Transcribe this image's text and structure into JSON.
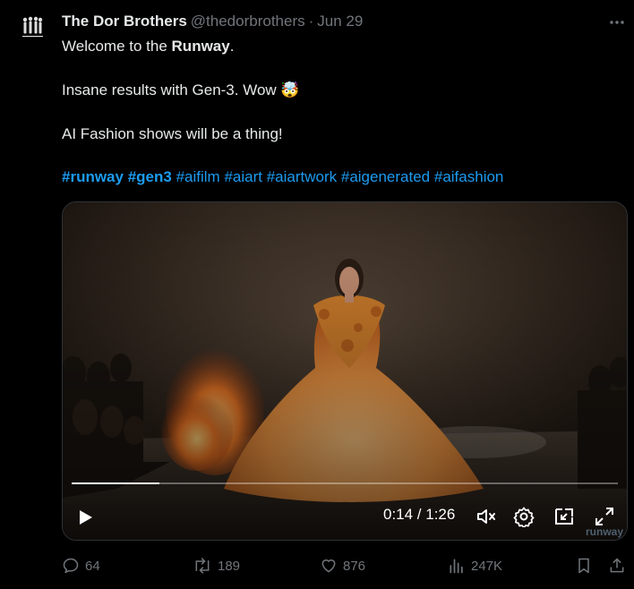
{
  "tweet": {
    "author_name": "The Dor Brothers",
    "handle": "@thedorbrothers",
    "separator": "·",
    "date": "Jun 29",
    "line1_prefix": "Welcome to the ",
    "line1_bold": "Runway",
    "line1_suffix": ".",
    "line2": "Insane results with Gen-3. Wow",
    "line2_emoji": "🤯",
    "line3": "AI Fashion shows will be a thing!",
    "hashtags": [
      {
        "text": "#runway",
        "bold": true
      },
      {
        "text": "#gen3",
        "bold": true
      },
      {
        "text": "#aifilm",
        "bold": false
      },
      {
        "text": "#aiart",
        "bold": false
      },
      {
        "text": "#aiartwork",
        "bold": false
      },
      {
        "text": "#aigenerated",
        "bold": false
      },
      {
        "text": "#aifashion",
        "bold": false
      }
    ]
  },
  "video": {
    "time_display": "0:14 / 1:26",
    "progress": 0.16,
    "watermark": "runway"
  },
  "actions": {
    "replies": "64",
    "reposts": "189",
    "likes": "876",
    "views": "247K"
  },
  "colors": {
    "background": "#000000",
    "text": "#e7e9ea",
    "muted": "#71767b",
    "link": "#1d9bf0"
  },
  "icons": [
    "more-icon",
    "play-icon",
    "mute-icon",
    "settings-icon",
    "pip-icon",
    "fullscreen-icon",
    "reply-icon",
    "repost-icon",
    "like-icon",
    "views-icon",
    "bookmark-icon",
    "share-icon"
  ]
}
